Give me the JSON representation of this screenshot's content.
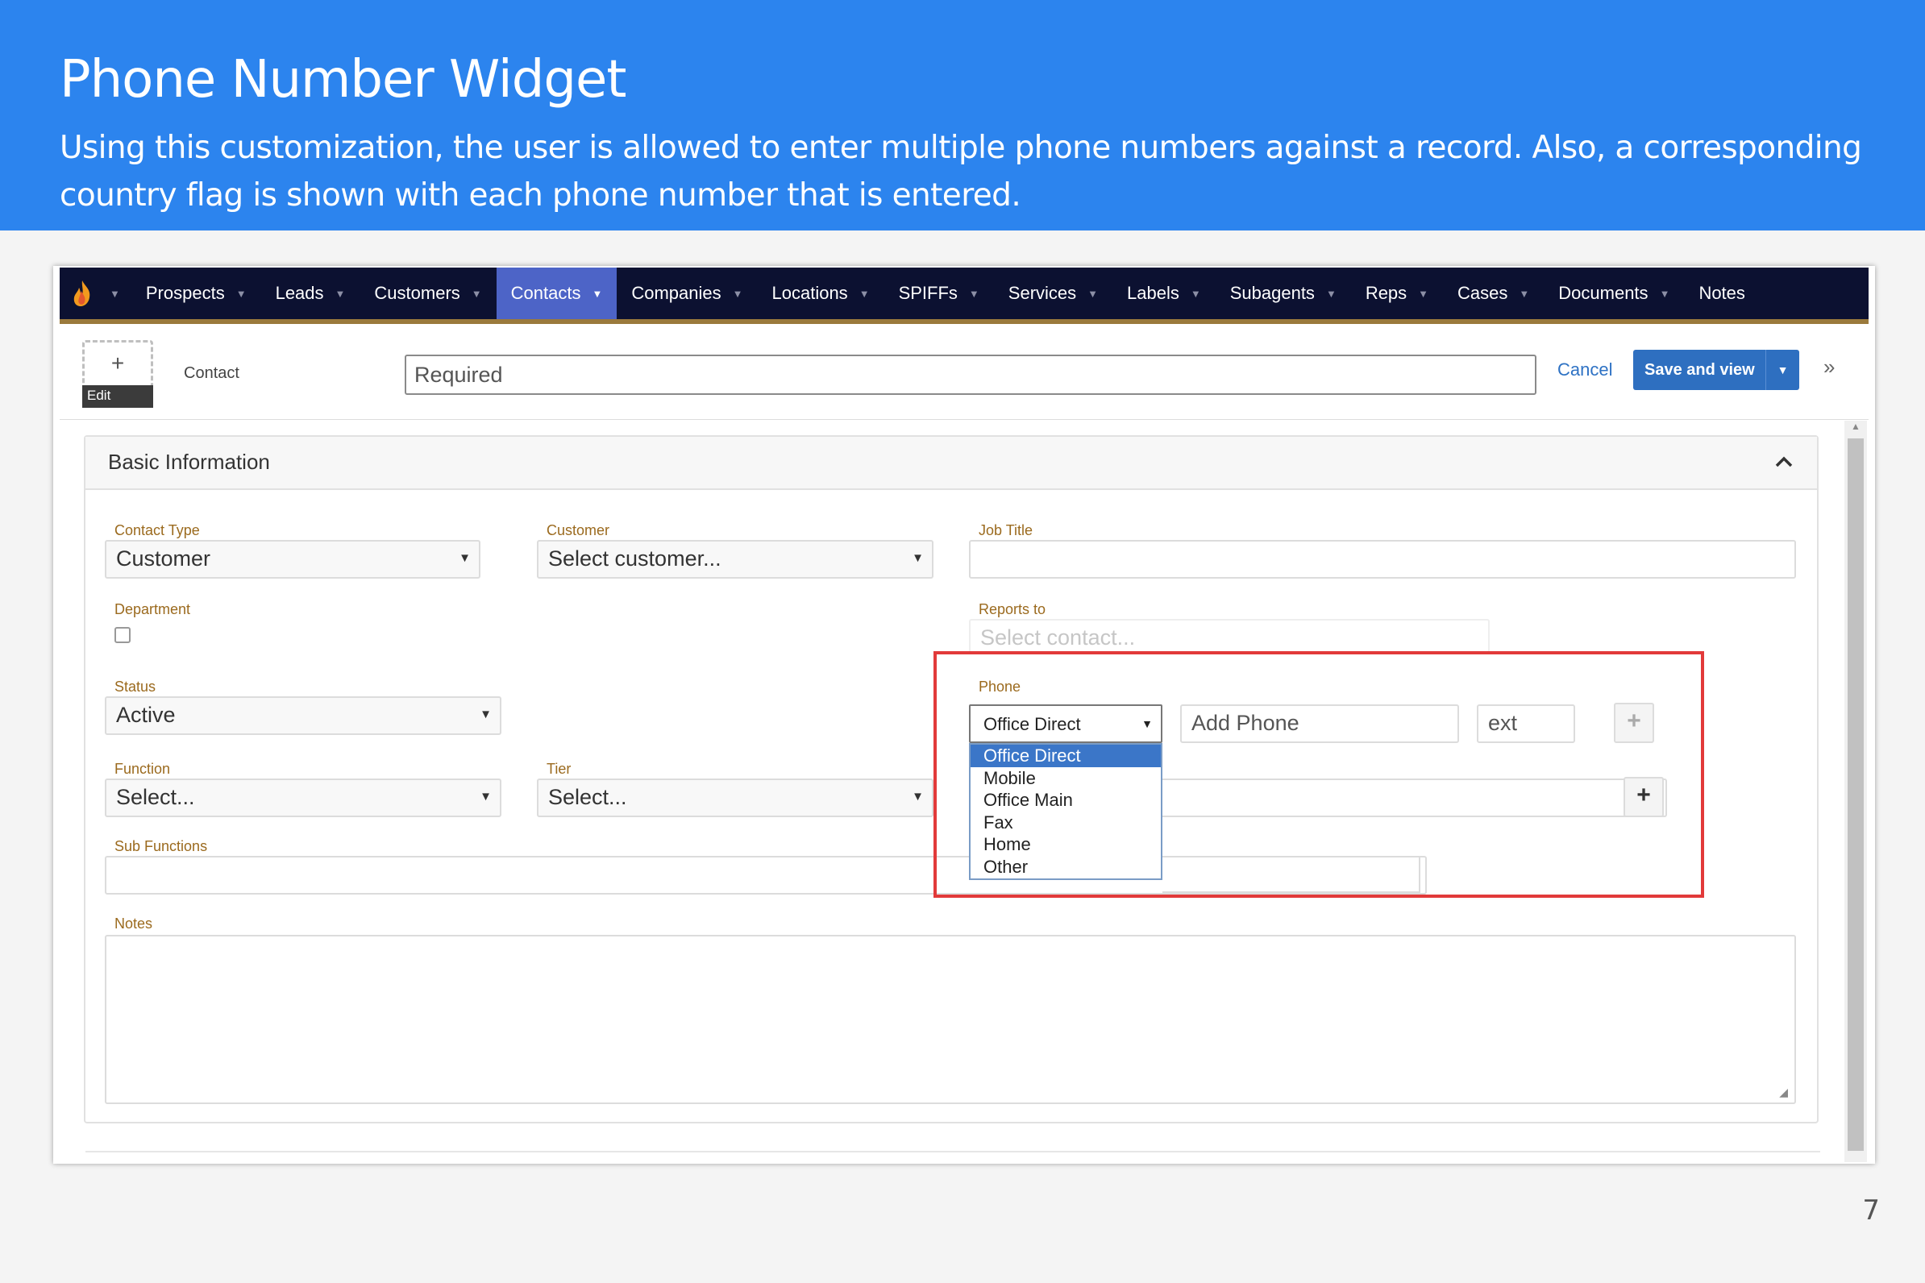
{
  "slide": {
    "title": "Phone Number Widget",
    "subtitle": "Using this customization, the user is allowed to enter multiple phone numbers against a record. Also, a corresponding country flag is shown with each phone number that is entered.",
    "page_number": "7"
  },
  "nav": {
    "logo_icon": "flame-icon",
    "items": [
      {
        "label": "Prospects"
      },
      {
        "label": "Leads"
      },
      {
        "label": "Customers"
      },
      {
        "label": "Contacts",
        "active": true
      },
      {
        "label": "Companies"
      },
      {
        "label": "Locations"
      },
      {
        "label": "SPIFFs"
      },
      {
        "label": "Services"
      },
      {
        "label": "Labels"
      },
      {
        "label": "Subagents"
      },
      {
        "label": "Reps"
      },
      {
        "label": "Cases"
      },
      {
        "label": "Documents"
      },
      {
        "label": "Notes"
      }
    ],
    "colors": {
      "bar": "#0c1131",
      "active": "#4d64c7",
      "underline": "#9b7a3c"
    }
  },
  "record": {
    "avatar_plus": "+",
    "avatar_edit": "Edit",
    "type_label": "Contact",
    "name_placeholder": "Required",
    "cancel": "Cancel",
    "save": "Save and view",
    "expand": "»"
  },
  "panel": {
    "title": "Basic Information",
    "fields": {
      "contact_type": {
        "label": "Contact Type",
        "value": "Customer"
      },
      "customer": {
        "label": "Customer",
        "value": "Select customer..."
      },
      "job_title": {
        "label": "Job Title",
        "value": ""
      },
      "department": {
        "label": "Department"
      },
      "reports_to": {
        "label": "Reports to",
        "value": "Select contact..."
      },
      "status": {
        "label": "Status",
        "value": "Active"
      },
      "function": {
        "label": "Function",
        "value": "Select..."
      },
      "tier": {
        "label": "Tier",
        "value": "Select..."
      },
      "sub_functions": {
        "label": "Sub Functions",
        "value": ""
      },
      "notes": {
        "label": "Notes",
        "value": ""
      }
    }
  },
  "phone": {
    "label": "Phone",
    "type_value": "Office Direct",
    "number_placeholder": "Add Phone",
    "ext_placeholder": "ext",
    "add_symbol": "+",
    "options": [
      "Office Direct",
      "Mobile",
      "Office Main",
      "Fax",
      "Home",
      "Other"
    ],
    "selected_option": "Office Direct",
    "highlight_color": "#e23a3a"
  }
}
